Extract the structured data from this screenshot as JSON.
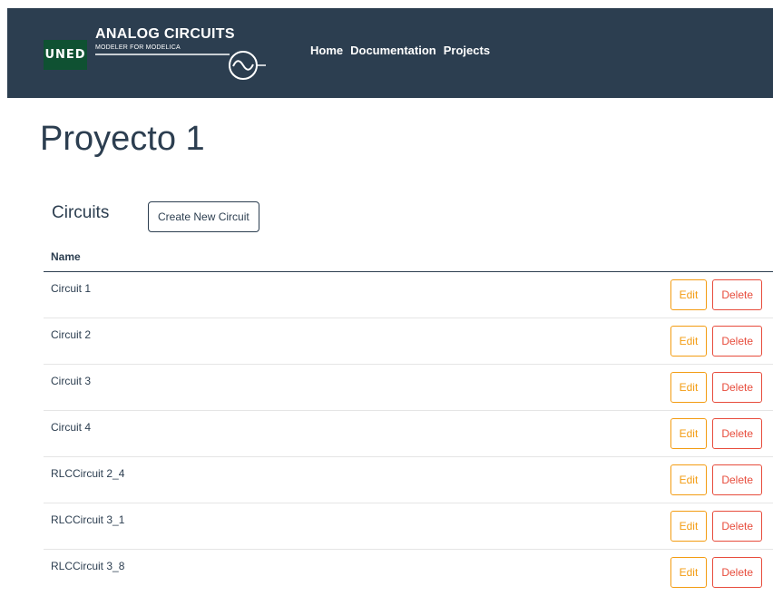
{
  "navbar": {
    "logo_text": "UNED",
    "brand_title": "ANALOG CIRCUITS",
    "brand_subtitle": "MODELER FOR MODELICA",
    "logo_color": "#0f5132",
    "background": "#2c3e50",
    "links": [
      "Home",
      "Documentation",
      "Projects"
    ]
  },
  "page": {
    "title": "Proyecto 1"
  },
  "circuits": {
    "section_title": "Circuits",
    "create_label": "Create New Circuit",
    "column_name": "Name",
    "edit_label": "Edit",
    "delete_label": "Delete",
    "edit_color": "#f39c12",
    "delete_color": "#e74c3c",
    "rows": [
      "Circuit 1",
      "Circuit 2",
      "Circuit 3",
      "Circuit 4",
      "RLCCircuit 2_4",
      "RLCCircuit 3_1",
      "RLCCircuit 3_8"
    ]
  }
}
